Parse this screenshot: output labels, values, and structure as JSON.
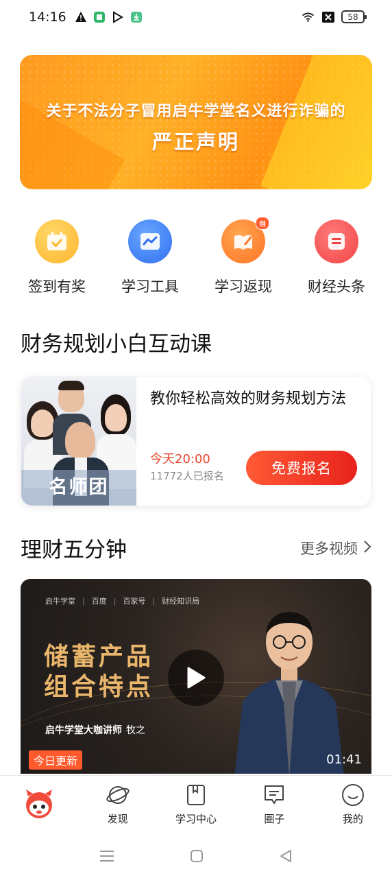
{
  "status_bar": {
    "time": "14:16",
    "battery": "58",
    "left_icons": [
      "warning-icon",
      "app-badge-icon",
      "play-store-icon",
      "download-icon"
    ],
    "right_icons": [
      "wifi-icon",
      "no-sim-icon",
      "battery-icon"
    ]
  },
  "banner": {
    "line1": "关于不法分子冒用启牛学堂名义进行诈骗的",
    "line2": "严正声明"
  },
  "quick_links": [
    {
      "label": "签到有奖",
      "icon": "calendar-check-icon"
    },
    {
      "label": "学习工具",
      "icon": "chart-line-icon"
    },
    {
      "label": "学习返现",
      "icon": "notebook-pen-icon",
      "badge": "赚"
    },
    {
      "label": "财经头条",
      "icon": "news-icon"
    }
  ],
  "section_course": {
    "title": "财务规划小白互动课",
    "card": {
      "image_tag": "名师团",
      "title": "教你轻松高效的财务规划方法",
      "time": "今天20:00",
      "count": "11772人已报名",
      "button": "免费报名"
    }
  },
  "section_video": {
    "title": "理财五分钟",
    "more": "更多视频",
    "video": {
      "brands": [
        "启牛学堂",
        "百度",
        "百家号",
        "财经知识局"
      ],
      "headline_line1": "储蓄产品",
      "headline_line2": "组合特点",
      "caption": "启牛学堂大咖讲师",
      "speaker": "牧之",
      "badge": "今日更新",
      "duration": "01:41"
    }
  },
  "tab_bar": {
    "tabs": [
      {
        "label": "",
        "icon": "mascot-icon"
      },
      {
        "label": "发现",
        "icon": "planet-icon"
      },
      {
        "label": "学习中心",
        "icon": "book-icon"
      },
      {
        "label": "圈子",
        "icon": "chat-icon"
      },
      {
        "label": "我的",
        "icon": "smile-icon"
      }
    ]
  },
  "colors": {
    "accent_red": "#e8231c",
    "accent_orange": "#ff9a1f",
    "video_gold": "#e9b66c"
  }
}
